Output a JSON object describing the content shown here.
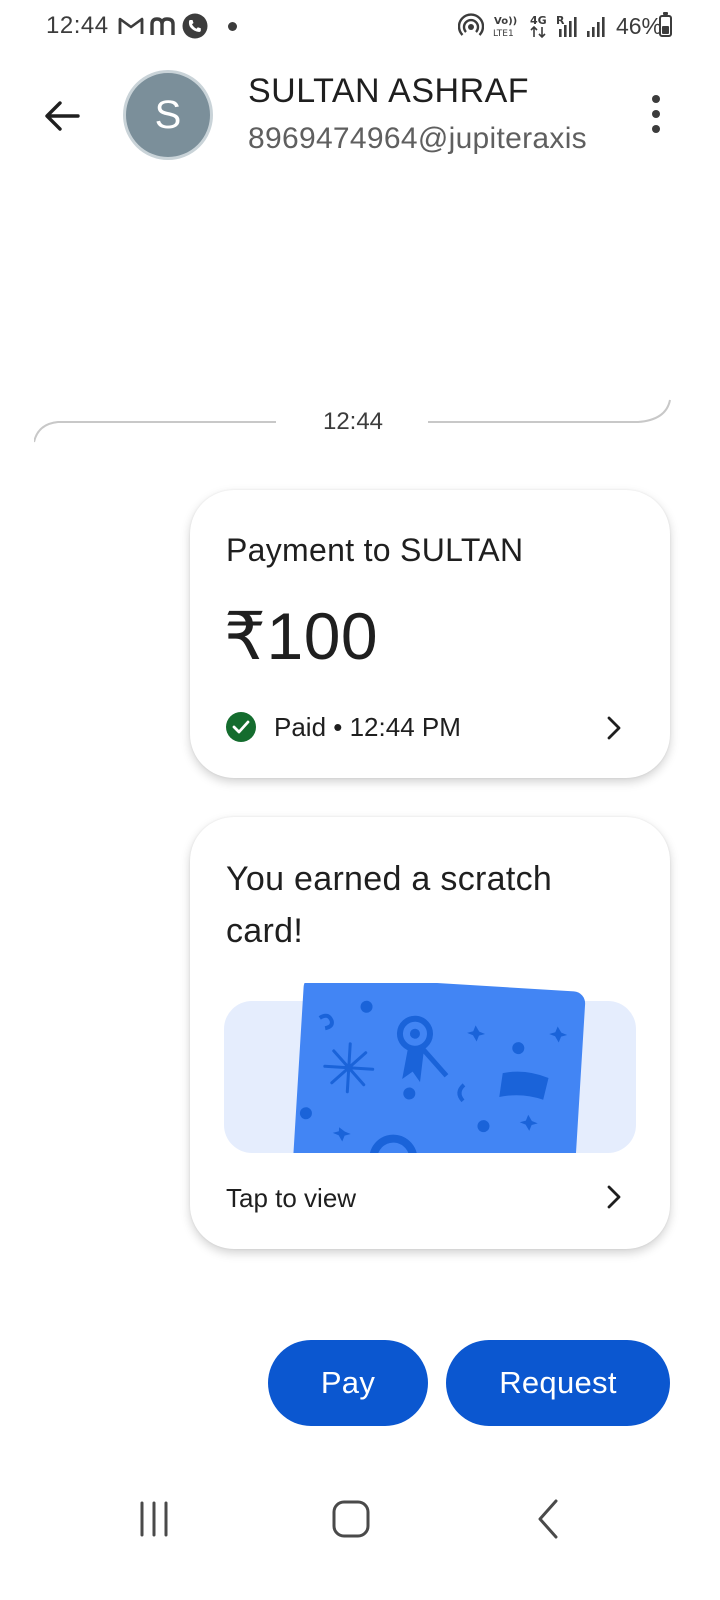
{
  "status_bar": {
    "time": "12:44",
    "battery_percent": "46%",
    "icons": [
      "gmail-icon",
      "m-app-icon",
      "phone-call-icon",
      "notification-dot",
      "hotspot-icon",
      "volte-icon",
      "4g-data-icon",
      "roaming-signal-icon",
      "signal-icon",
      "battery-icon"
    ],
    "volte_label": "Vo)) LTE1",
    "network_label": "4G",
    "roaming_label": "R"
  },
  "header": {
    "avatar_initial": "S",
    "contact_name": "SULTAN ASHRAF",
    "upi_id": "8969474964@jupiteraxis"
  },
  "chat": {
    "timestamp": "12:44"
  },
  "payment_card": {
    "title": "Payment to SULTAN",
    "amount": "₹100",
    "status": "Paid • 12:44 PM"
  },
  "scratch_card": {
    "title": "You earned a scratch card!",
    "tap_label": "Tap to view"
  },
  "actions": {
    "pay_label": "Pay",
    "request_label": "Request"
  },
  "colors": {
    "primary": "#0b57d0",
    "success": "#146c2e",
    "scratch_card": "#4285f4",
    "scratch_bg": "#e5edfd",
    "avatar": "#7b8f9a"
  }
}
